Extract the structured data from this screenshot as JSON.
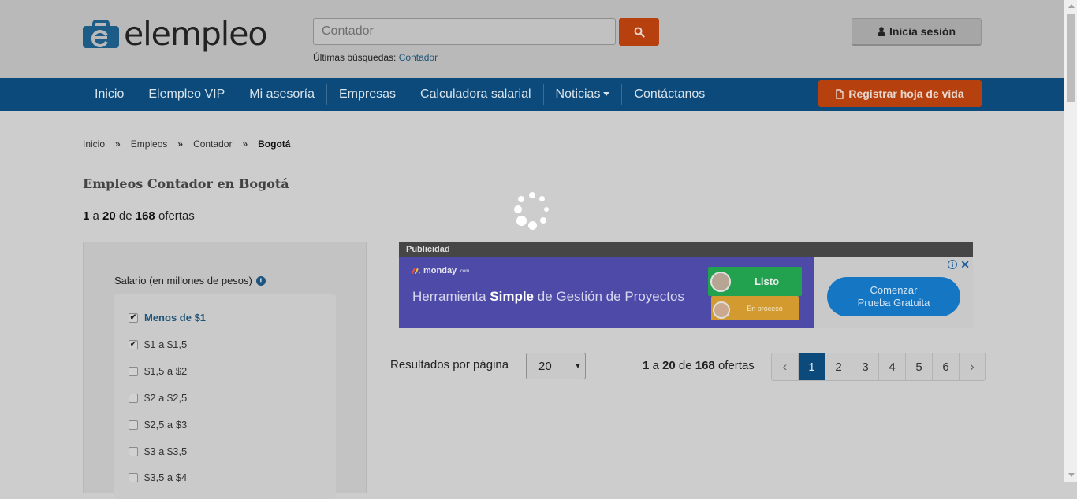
{
  "header": {
    "logo_text": "elempleo",
    "search": {
      "placeholder": "Contador",
      "value": ""
    },
    "recent_label": "Últimas búsquedas:",
    "recent_link": "Contador",
    "login_label": "Inicia sesión"
  },
  "nav": {
    "items": [
      "Inicio",
      "Elempleo VIP",
      "Mi asesoría",
      "Empresas",
      "Calculadora salarial",
      "Noticias",
      "Contáctanos"
    ],
    "register_label": "Registrar hoja de vida"
  },
  "breadcrumb": {
    "items": [
      "Inicio",
      "Empleos",
      "Contador",
      "Bogotá"
    ],
    "separator": "»"
  },
  "page": {
    "title": "Empleos Contador en Bogotá",
    "count": {
      "from": "1",
      "a": "a",
      "to": "20",
      "de": "de",
      "total": "168",
      "suffix": "ofertas"
    }
  },
  "filter": {
    "title": "Salario (en millones de pesos)",
    "options": [
      {
        "label": "Menos de $1",
        "checked": true
      },
      {
        "label": "$1 a $1,5",
        "checked": true
      },
      {
        "label": "$1,5 a $2",
        "checked": false
      },
      {
        "label": "$2 a $2,5",
        "checked": false
      },
      {
        "label": "$2,5 a $3",
        "checked": false
      },
      {
        "label": "$3 a $3,5",
        "checked": false
      },
      {
        "label": "$3,5 a $4",
        "checked": false
      }
    ]
  },
  "ad": {
    "label": "Publicidad",
    "brand": "monday",
    "brand_suffix": ".com",
    "text_before": "Herramienta ",
    "text_bold": "Simple",
    "text_after": " de Gestión de Proyectos",
    "status_done": "Listo",
    "status_progress": "En proceso",
    "cta_line1": "Comenzar",
    "cta_line2": "Prueba Gratuita"
  },
  "results": {
    "per_page_label": "Resultados por página",
    "per_page_value": "20",
    "pages": [
      "1",
      "2",
      "3",
      "4",
      "5",
      "6"
    ],
    "active_page": "1",
    "prev_symbol": "‹",
    "next_symbol": "›"
  },
  "colors": {
    "nav_bg": "#0b4a7a",
    "accent_orange": "#b6410f",
    "link_blue": "#1f5479"
  }
}
